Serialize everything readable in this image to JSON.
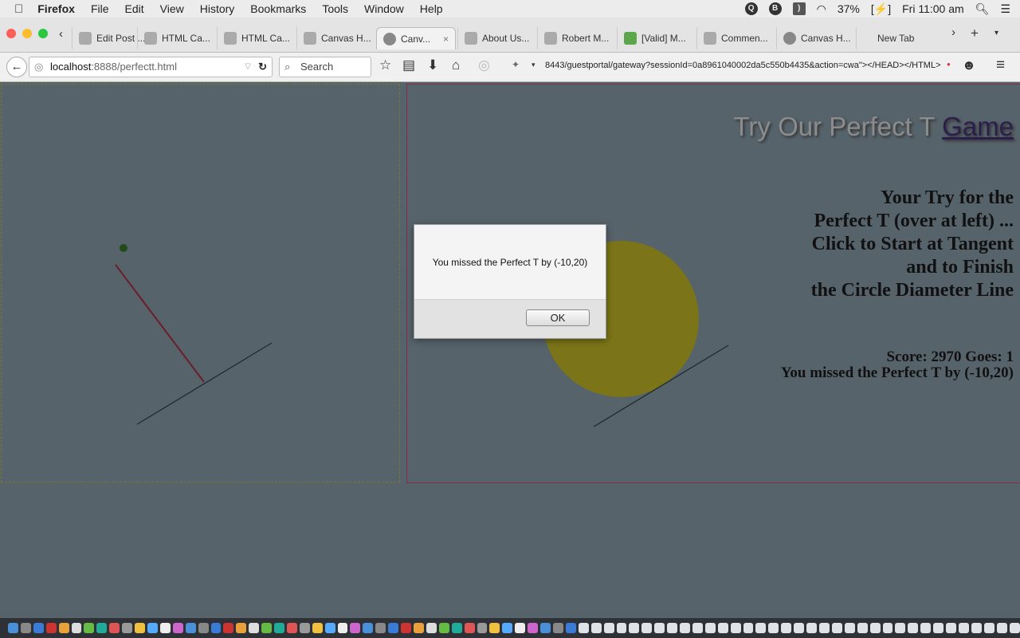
{
  "menubar": {
    "apple": "",
    "app": "Firefox",
    "items": [
      "File",
      "Edit",
      "View",
      "History",
      "Bookmarks",
      "Tools",
      "Window",
      "Help"
    ],
    "battery": "37%",
    "clock": "Fri 11:00 am"
  },
  "tabs": [
    {
      "label": "Edit Post ...",
      "active": false
    },
    {
      "label": "HTML Ca...",
      "active": false
    },
    {
      "label": "HTML Ca...",
      "active": false
    },
    {
      "label": "Canvas H...",
      "active": false
    },
    {
      "label": "Canv...",
      "active": true
    },
    {
      "label": "About Us...",
      "active": false
    },
    {
      "label": "Robert M...",
      "active": false
    },
    {
      "label": "[Valid] M...",
      "active": false
    },
    {
      "label": "Commen...",
      "active": false
    },
    {
      "label": "Canvas H...",
      "active": false
    },
    {
      "label": "New Tab",
      "active": false
    }
  ],
  "nav": {
    "url_host": "localhost",
    "url_rest": ":8888/perfectt.html",
    "search_placeholder": "Search",
    "second_address": "8443/guestportal/gateway?sessionId=0a8961040002da5c550b4435&action=cwa\"></HEAD></HTML>"
  },
  "page": {
    "title_text": "Try Our Perfect T ",
    "title_link": "Game",
    "instructions": [
      "Your Try for the",
      "Perfect T (over at left) ...",
      "Click to Start at Tangent",
      "and to Finish",
      "the Circle Diameter Line"
    ],
    "score_line": "Score: 2970 Goes: 1",
    "result_line": "You missed the Perfect T by (-10,20)"
  },
  "dialog": {
    "message": "You missed the Perfect T by (-10,20)",
    "ok_label": "OK"
  },
  "colors": {
    "page_bg": "#56636b",
    "circle": "#7b7418",
    "user_line": "#6b1e2a",
    "tangent_line": "#1e2a30",
    "dot": "#224a1a"
  }
}
